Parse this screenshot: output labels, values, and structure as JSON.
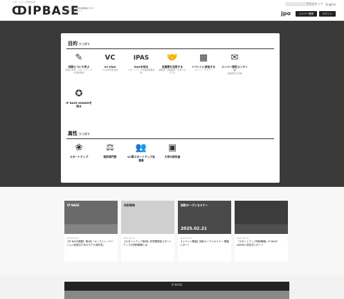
{
  "header": {
    "logo": "IPBASE",
    "logo_tag": "スタートアップ知財支援",
    "logo_sub": "スタートアップの知財戦略をサポートするポータルサイト",
    "top_links": [
      "サイトマップ",
      "English"
    ],
    "brand_mark": "jpo",
    "buttons": [
      "メンバー登録",
      "ログイン"
    ]
  },
  "purpose": {
    "title": "目的",
    "suffix": "から探す",
    "items": [
      {
        "icon": "learn-icon",
        "glyph": "✎",
        "label": "知財について学ぶ",
        "desc": "知財の基本・スタートアップの知財事例"
      },
      {
        "icon": "vc-ipas-icon",
        "glyph": "VC",
        "label": "VC-IPAS",
        "desc": "VCの専門家派遣"
      },
      {
        "icon": "ipas-icon",
        "glyph": "IPAS",
        "label": "IPASを知る",
        "desc": "スタートアップの知財戦略支援"
      },
      {
        "icon": "handshake-icon",
        "glyph": "🤝",
        "label": "支援策を活用する",
        "desc": "補助金・減免制度・支援プログラム"
      },
      {
        "icon": "event-icon",
        "glyph": "▦",
        "label": "イベントに参加する",
        "desc": "イベント・セミナー"
      },
      {
        "icon": "member-content-icon",
        "glyph": "✉",
        "label": "メンバー限定コンテンツ",
        "desc": "会員限定の記事"
      },
      {
        "icon": "award-icon",
        "glyph": "✪",
        "label": "IP BASE AWARDを知る",
        "desc": ""
      }
    ]
  },
  "attribute": {
    "title": "属性",
    "suffix": "から探す",
    "items": [
      {
        "icon": "startup-icon",
        "glyph": "❀",
        "label": "スタートアップ",
        "desc": ""
      },
      {
        "icon": "ip-expert-icon",
        "glyph": "⚖",
        "label": "知財専門家",
        "desc": ""
      },
      {
        "icon": "vc-icon",
        "glyph": "👥",
        "label": "VC等スタートアップ支援者",
        "desc": ""
      },
      {
        "icon": "university-icon",
        "glyph": "▣",
        "label": "大学の研究者",
        "desc": ""
      }
    ]
  },
  "news": [
    {
      "date": "2025.02.25",
      "thumb_title": "IP BASE",
      "thumb_big": "",
      "text": "【IP BASE連載】第4回「オープンイノベーション促進のためのモデル契約書」"
    },
    {
      "date": "2025.02.21",
      "thumb_title": "知財戦略",
      "thumb_big": "",
      "text": "【スタートアップ事例】研究開発型スタートアップの知財戦略とは"
    },
    {
      "date": "2025.02.21",
      "thumb_title": "知財オープンセミナー",
      "thumb_big": "2025.02.21",
      "text": "【イベント開催】知財オープンセミナー 開催レポート"
    },
    {
      "date": "2025.02.18",
      "thumb_title": "",
      "thumb_big": "",
      "text": "「スタートアップ知財戦略」IP BASE AWARD 授賞式レポート"
    }
  ],
  "band": {
    "label": "IP BASE"
  }
}
